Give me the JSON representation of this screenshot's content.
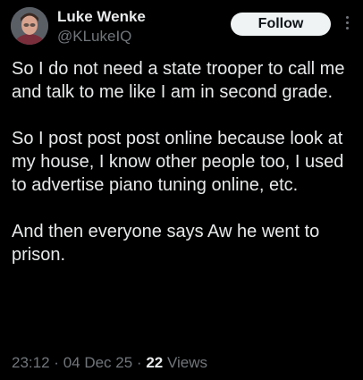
{
  "author": {
    "name": "Luke Wenke",
    "handle": "@KLukeIQ",
    "avatar_icon": "profile-photo"
  },
  "follow_label": "Follow",
  "more_icon": "more-vertical-icon",
  "paragraphs": [
    "So I do not need a state trooper to call me and talk to me like I am in second grade.",
    "So I post post post online because look at my house, I know other people too, I used to advertise piano tuning online, etc.",
    "And then everyone says Aw he went to prison."
  ],
  "meta": {
    "time": "23:12",
    "separator": "·",
    "date": "04 Dec 25",
    "views_count": "22",
    "views_label": "Views"
  },
  "colors": {
    "background": "#000000",
    "text": "#e7e9ea",
    "secondary": "#71767b",
    "button_bg": "#eff3f4",
    "button_text": "#0f1419"
  }
}
